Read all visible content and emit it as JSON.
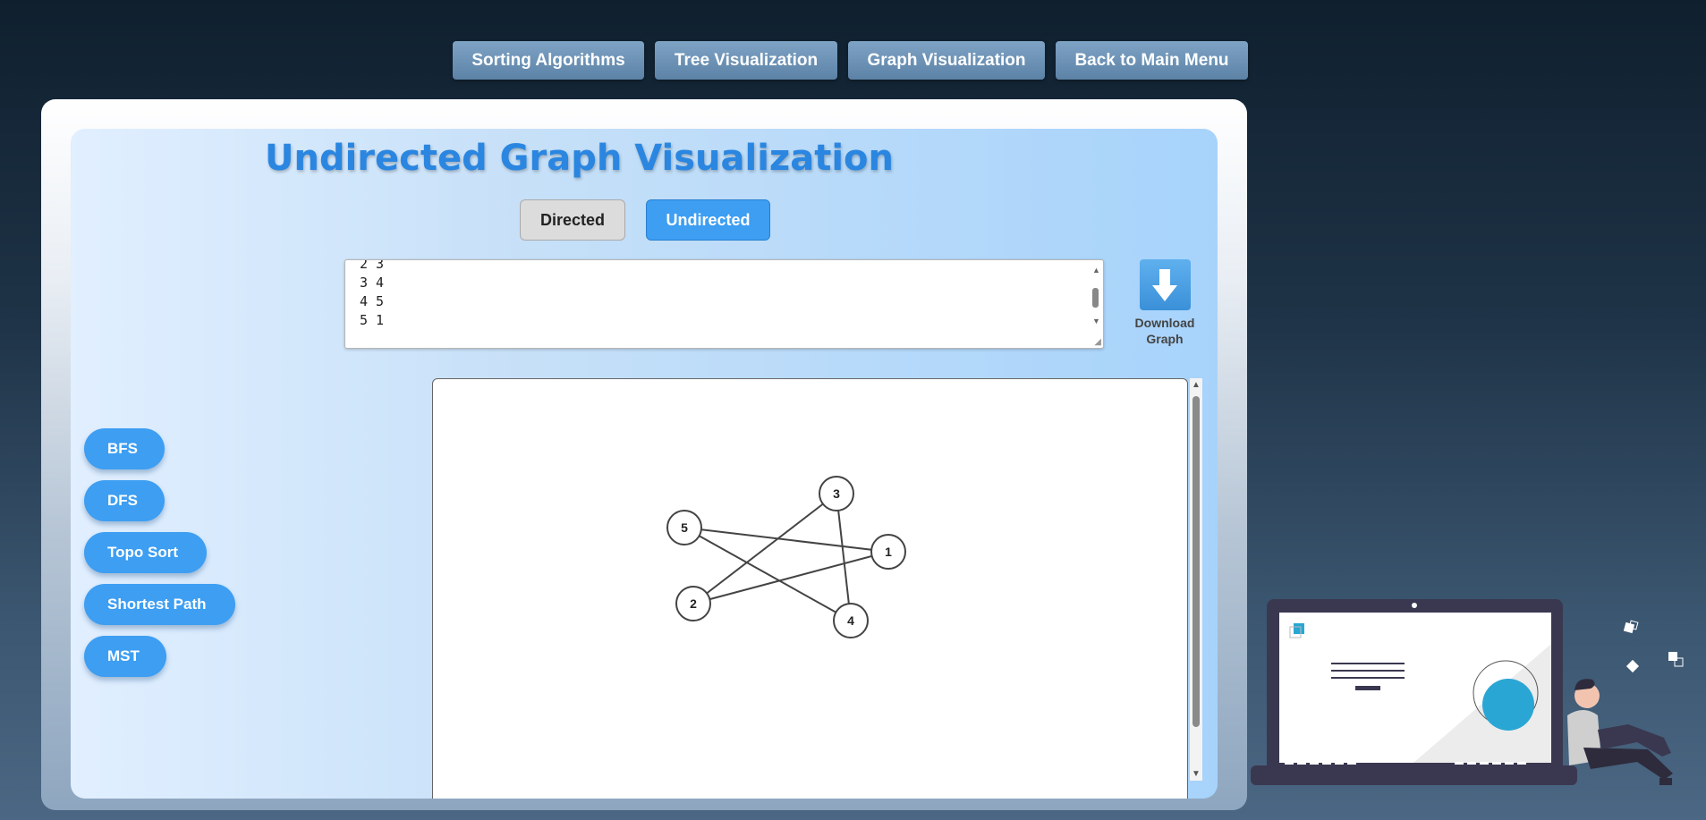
{
  "nav": {
    "items": [
      {
        "label": "Sorting Algorithms"
      },
      {
        "label": "Tree Visualization"
      },
      {
        "label": "Graph Visualization"
      },
      {
        "label": "Back to Main Menu"
      }
    ]
  },
  "page": {
    "title": "Undirected Graph Visualization"
  },
  "mode_toggle": {
    "directed_label": "Directed",
    "undirected_label": "Undirected",
    "selected": "Undirected"
  },
  "edge_input": {
    "lines": [
      "2 3",
      "3 4",
      "4 5",
      "5 1"
    ]
  },
  "download": {
    "label_line1": "Download",
    "label_line2": "Graph"
  },
  "algorithms": [
    {
      "label": "BFS"
    },
    {
      "label": "DFS"
    },
    {
      "label": "Topo Sort"
    },
    {
      "label": "Shortest Path"
    },
    {
      "label": "MST"
    }
  ],
  "graph": {
    "nodes": [
      {
        "id": "1",
        "label": "1"
      },
      {
        "id": "2",
        "label": "2"
      },
      {
        "id": "3",
        "label": "3"
      },
      {
        "id": "4",
        "label": "4"
      },
      {
        "id": "5",
        "label": "5"
      }
    ],
    "edges": [
      [
        "3",
        "2"
      ],
      [
        "3",
        "4"
      ],
      [
        "5",
        "1"
      ],
      [
        "5",
        "4"
      ],
      [
        "2",
        "1"
      ]
    ]
  },
  "colors": {
    "accent": "#3d9ef2",
    "title": "#2a86e0",
    "nav": "#6a8fb3"
  }
}
